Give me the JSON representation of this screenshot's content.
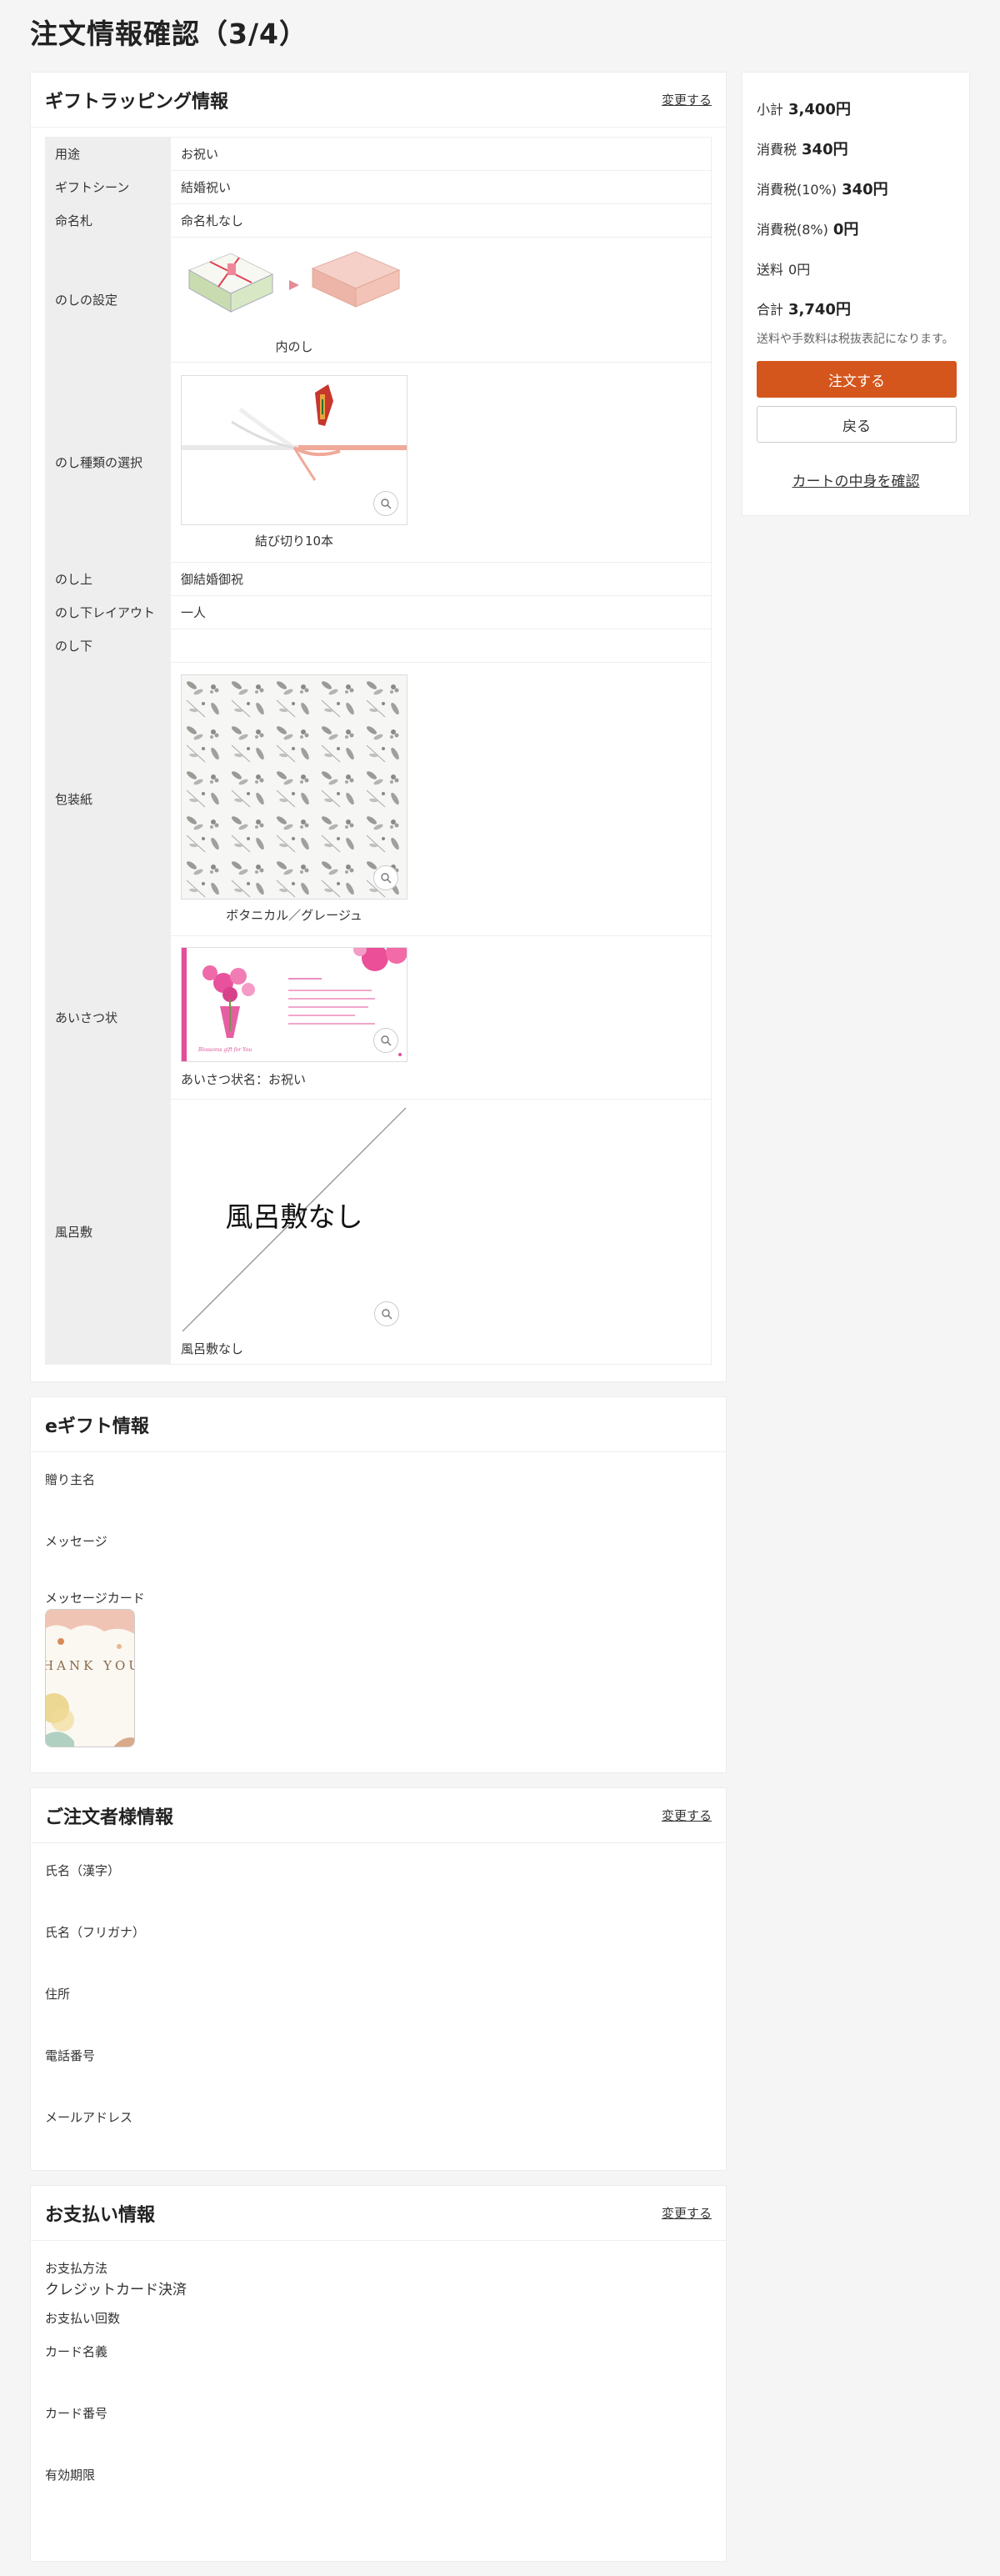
{
  "page": {
    "title": "注文情報確認（3/4）"
  },
  "gift_wrapping": {
    "title": "ギフトラッピング情報",
    "change_label": "変更する",
    "rows": {
      "usage": {
        "label": "用途",
        "value": "お祝い"
      },
      "scene": {
        "label": "ギフトシーン",
        "value": "結婚祝い"
      },
      "name_card": {
        "label": "命名札",
        "value": "命名札なし"
      },
      "noshi_setting": {
        "label": "のしの設定",
        "caption": "内のし"
      },
      "noshi_type": {
        "label": "のし種類の選択",
        "caption": "結び切り10本"
      },
      "noshi_top": {
        "label": "のし上",
        "value": "御結婚御祝"
      },
      "noshi_layout": {
        "label": "のし下レイアウト",
        "value": "一人"
      },
      "noshi_bottom": {
        "label": "のし下",
        "value": ""
      },
      "wrapping_paper": {
        "label": "包装紙",
        "caption": "ボタニカル／グレージュ"
      },
      "greeting_card": {
        "label": "あいさつ状",
        "caption": "あいさつ状名：お祝い",
        "thumb_text": "Blossoms gift for You"
      },
      "furoshiki": {
        "label": "風呂敷",
        "image_text": "風呂敷なし",
        "caption": "風呂敷なし"
      }
    }
  },
  "egift": {
    "title": "eギフト情報",
    "sender_label": "贈り主名",
    "message_label": "メッセージ",
    "card_label": "メッセージカード",
    "card_text": "THANK YOU!"
  },
  "customer": {
    "title": "ご注文者様情報",
    "change_label": "変更する",
    "fields": [
      "氏名（漢字）",
      "氏名（フリガナ）",
      "住所",
      "電話番号",
      "メールアドレス"
    ]
  },
  "payment": {
    "title": "お支払い情報",
    "change_label": "変更する",
    "method_label": "お支払方法",
    "method_value": "クレジットカード決済",
    "installments_label": "お支払い回数",
    "fields": [
      "カード名義",
      "カード番号",
      "有効期限"
    ]
  },
  "summary": {
    "subtotal_label": "小計",
    "subtotal": "3,400円",
    "tax_label": "消費税",
    "tax": "340円",
    "tax10_label": "消費税(10%)",
    "tax10": "340円",
    "tax8_label": "消費税(8%)",
    "tax8": "0円",
    "shipping_label": "送料",
    "shipping": "0円",
    "total_label": "合計",
    "total": "3,740円",
    "note": "送料や手数料は税抜表記になります。",
    "order_button": "注文する",
    "back_button": "戻る",
    "cart_link": "カートの中身を確認"
  },
  "colors": {
    "accent": "#d4561c",
    "label_bg": "#eeeeee",
    "page_bg": "#f5f5f5"
  }
}
